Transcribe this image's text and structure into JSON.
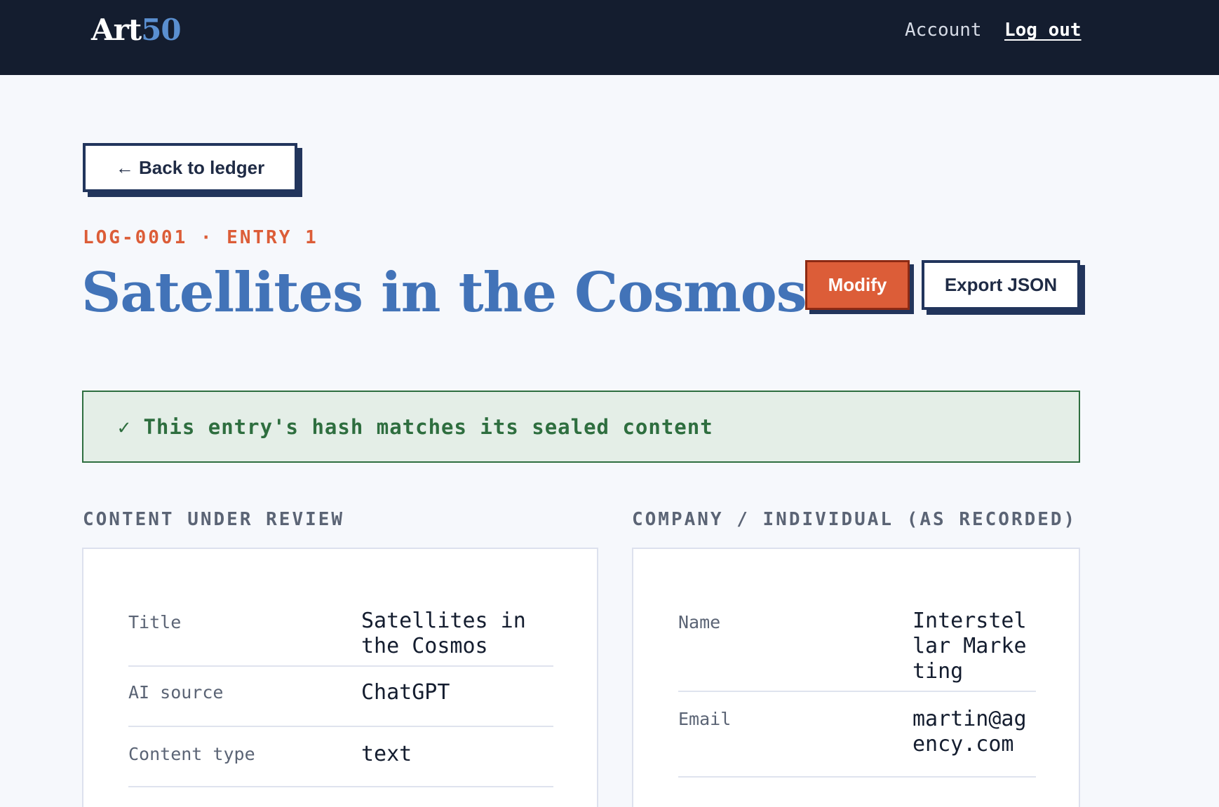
{
  "header": {
    "logo_part1": "Art",
    "logo_part2": "50",
    "account_link": "Account",
    "logout_link": "Log out"
  },
  "back_button": "← Back to ledger",
  "meta": "LOG-0001 · ENTRY 1",
  "title": "Satellites in the Cosmos",
  "actions": {
    "modify": "Modify",
    "export": "Export JSON"
  },
  "verification": {
    "check": "✓",
    "message": "This entry's hash matches its sealed content"
  },
  "content_section": {
    "label": "CONTENT UNDER REVIEW",
    "rows": [
      {
        "key": "Title",
        "value": "Satellites in the Cosmos"
      },
      {
        "key": "AI source",
        "value": "ChatGPT"
      },
      {
        "key": "Content type",
        "value": "text"
      }
    ]
  },
  "company_section": {
    "label": "COMPANY / INDIVIDUAL (AS RECORDED)",
    "rows": [
      {
        "key": "Name",
        "value": "Interstellar Marketing"
      },
      {
        "key": "Email",
        "value": "martin@agency.com"
      }
    ]
  },
  "colors": {
    "header_bg": "#141d2f",
    "accent_blue": "#4273b8",
    "accent_orange": "#dc5d38",
    "success_green": "#2e6e3f",
    "navy": "#22355c"
  }
}
